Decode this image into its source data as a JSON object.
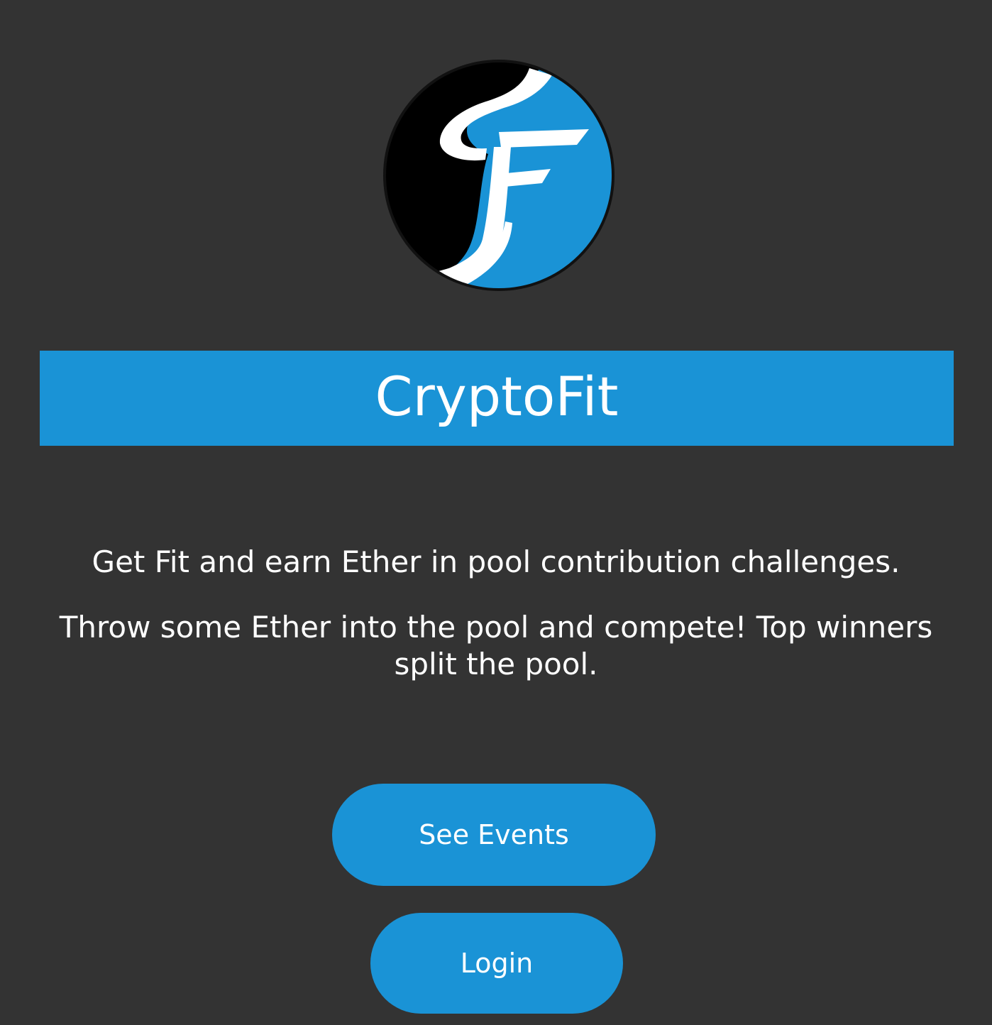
{
  "app": {
    "title": "CryptoFit",
    "logo_icon": "cryptofit-cf-logo-icon"
  },
  "hero": {
    "tagline_primary": "Get Fit and earn Ether in pool contribution challenges.",
    "tagline_secondary": "Throw some Ether into the pool and compete! Top winners split the pool."
  },
  "actions": {
    "see_events_label": "See Events",
    "login_label": "Login"
  },
  "colors": {
    "background": "#333333",
    "accent": "#1a93d6",
    "text": "#ffffff",
    "logo_dark": "#000000"
  }
}
